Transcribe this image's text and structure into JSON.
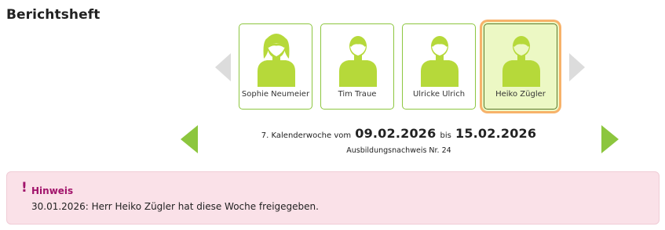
{
  "page": {
    "title": "Berichtsheft"
  },
  "colors": {
    "accent_green": "#8cc63e",
    "avatar_green": "#b6d93a",
    "selected_bg": "#ecf8c4",
    "selected_outline": "#f7b26a",
    "notice_bg": "#fae1e8",
    "notice_accent": "#a1146b"
  },
  "carousel": {
    "prev_icon": "chevron-left-icon",
    "next_icon": "chevron-right-icon",
    "trainees": [
      {
        "name": "Sophie Neumeier",
        "avatar": "female-avatar-icon",
        "selected": false
      },
      {
        "name": "Tim Traue",
        "avatar": "male-avatar-icon",
        "selected": false
      },
      {
        "name": "Ulricke Ulrich",
        "avatar": "male-avatar-icon",
        "selected": false
      },
      {
        "name": "Heiko Zügler",
        "avatar": "male-avatar-icon",
        "selected": true
      }
    ]
  },
  "week": {
    "prefix": "7. Kalenderwoche vom",
    "start_date": "09.02.2026",
    "separator": "bis",
    "end_date": "15.02.2026",
    "record": "Ausbildungsnachweis Nr. 24",
    "prev_icon": "triangle-left-icon",
    "next_icon": "triangle-right-icon"
  },
  "notice": {
    "icon": "!",
    "title": "Hinweis",
    "text": "30.01.2026: Herr Heiko Zügler hat diese Woche freigegeben."
  }
}
